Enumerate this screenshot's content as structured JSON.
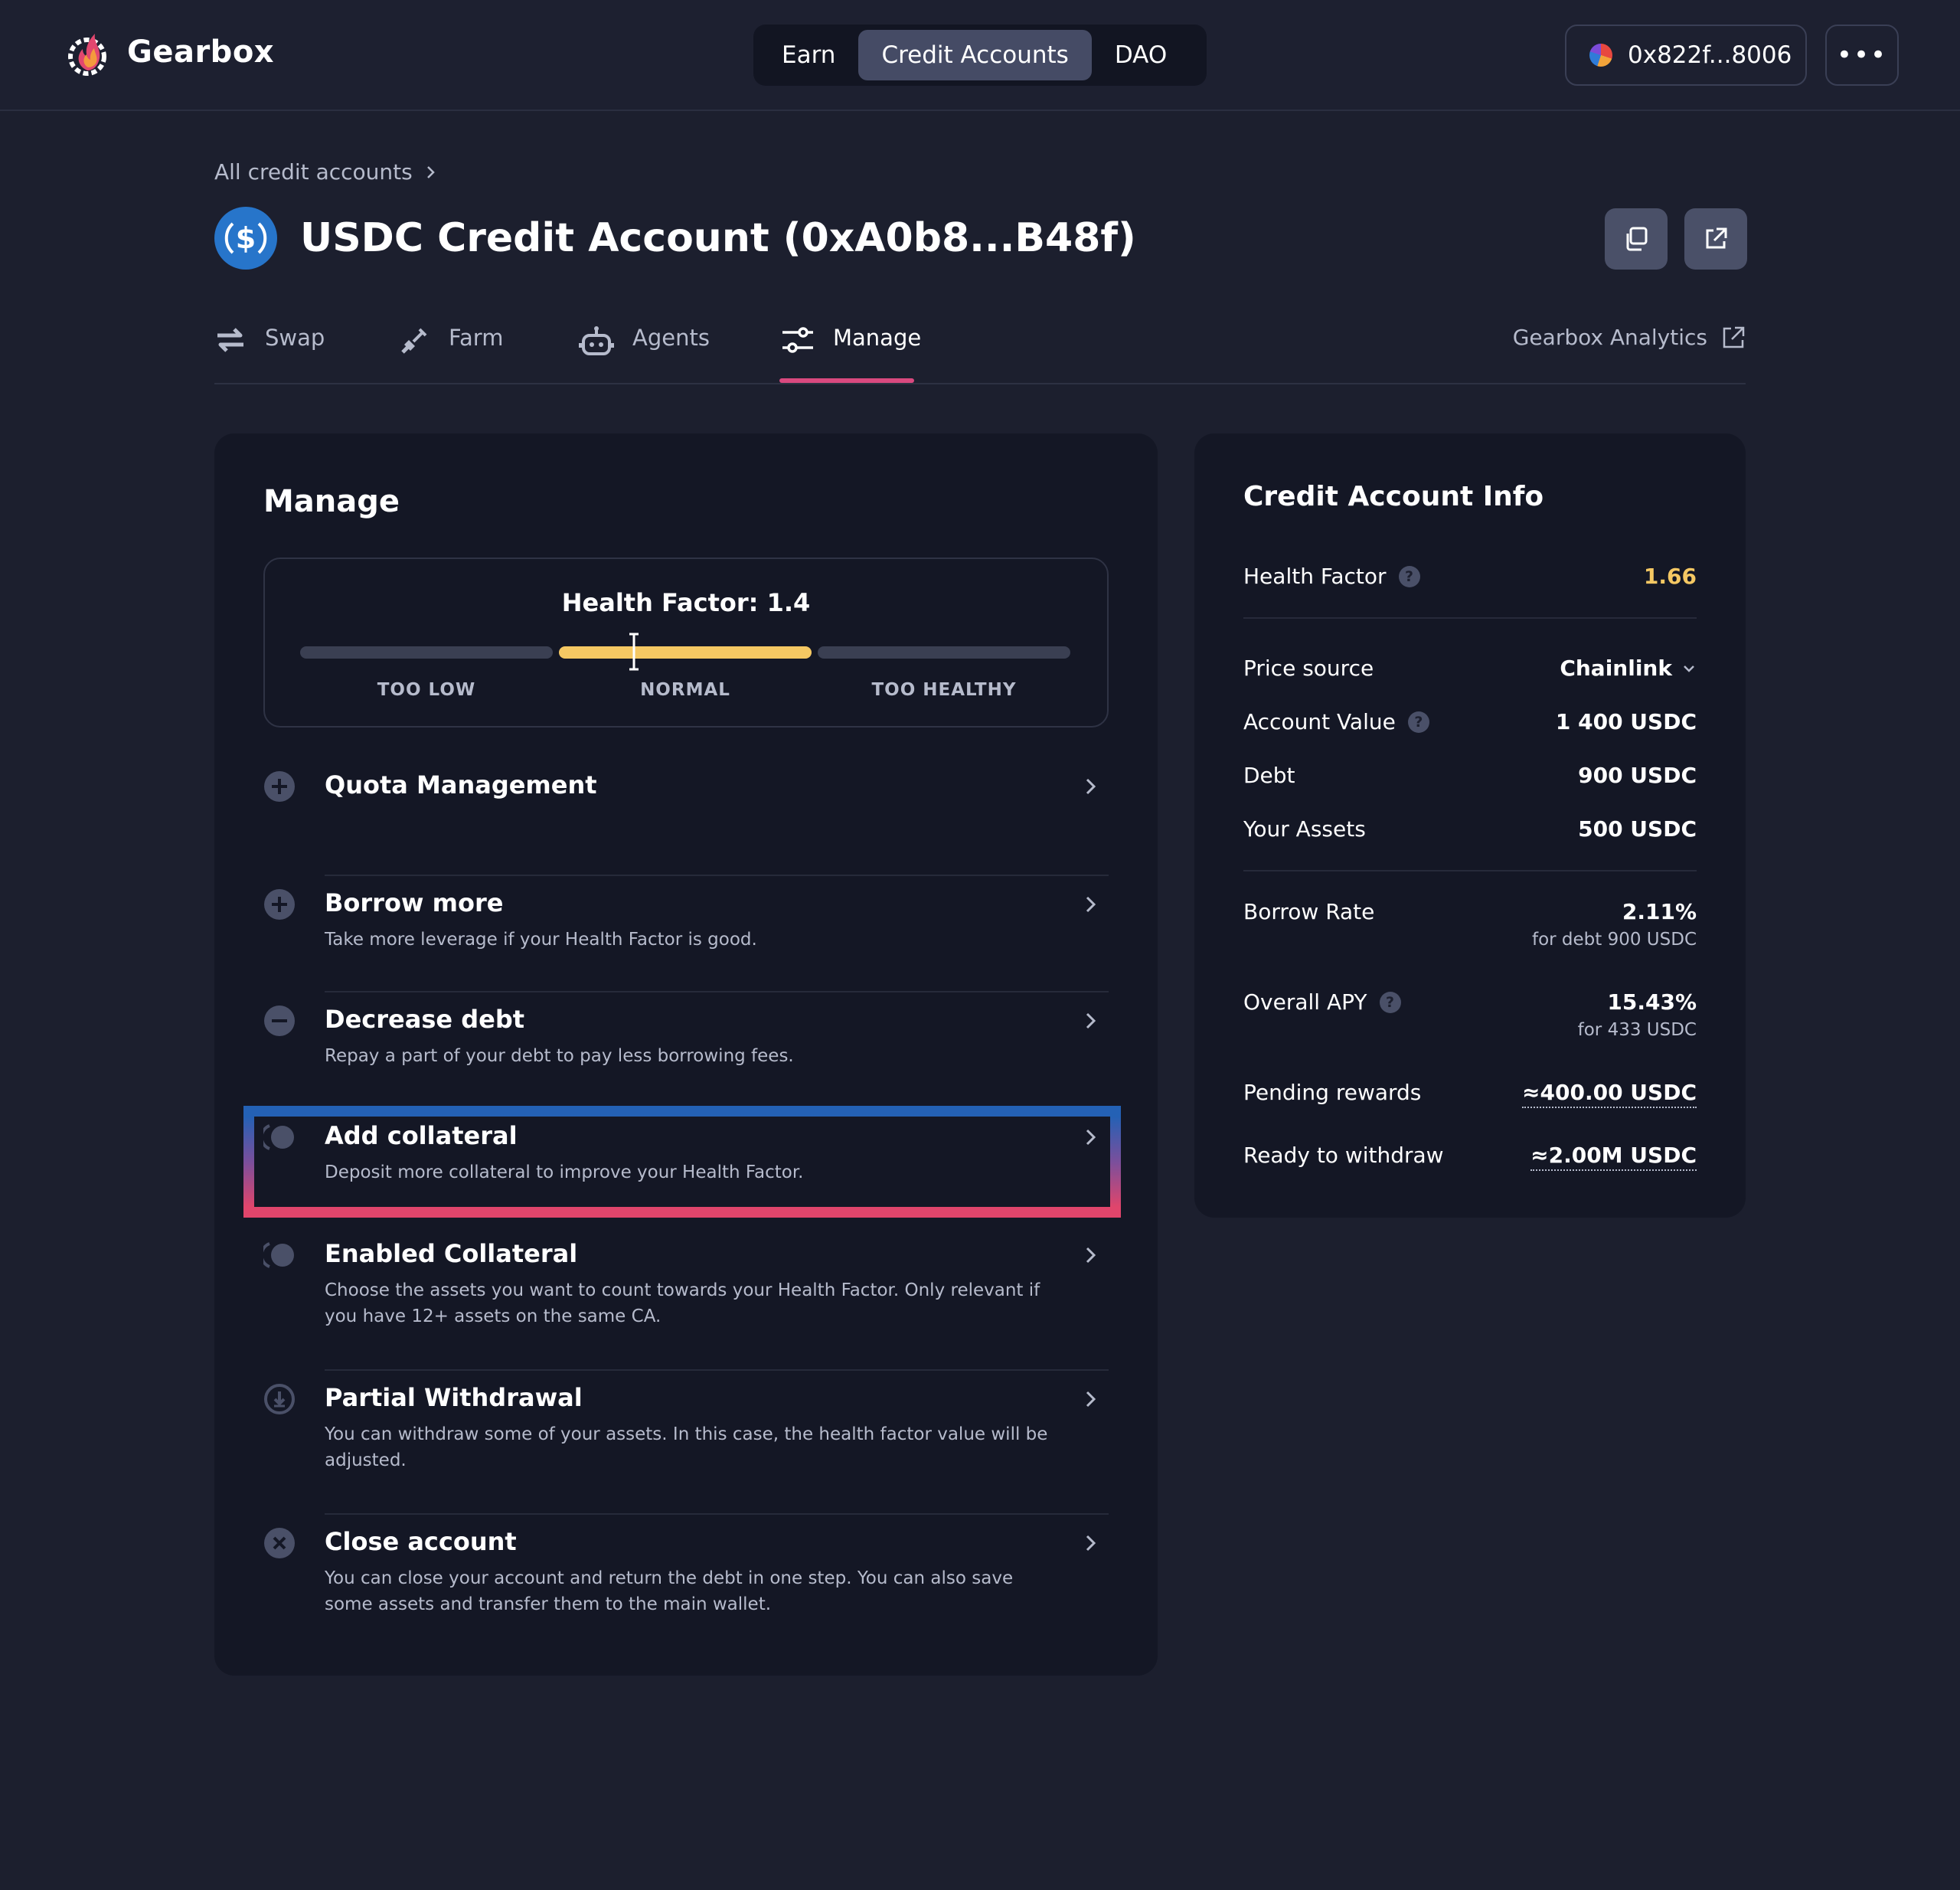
{
  "header": {
    "brand": "Gearbox",
    "nav": [
      {
        "label": "Earn",
        "active": false
      },
      {
        "label": "Credit Accounts",
        "active": true
      },
      {
        "label": "DAO",
        "active": false
      }
    ],
    "wallet_address": "0x822f...8006",
    "more_label": "•••"
  },
  "breadcrumb": {
    "link": "All credit accounts"
  },
  "page": {
    "title": "USDC Credit Account (0xA0b8...B48f)"
  },
  "tabs": [
    {
      "label": "Swap",
      "icon": "swap-icon"
    },
    {
      "label": "Farm",
      "icon": "shovel-icon"
    },
    {
      "label": "Agents",
      "icon": "robot-icon"
    },
    {
      "label": "Manage",
      "icon": "sliders-icon",
      "active": true
    }
  ],
  "analytics_link": "Gearbox Analytics",
  "manage": {
    "title": "Manage",
    "health": {
      "label": "Health Factor: 1.4",
      "value": 1.4,
      "zones": [
        "TOO LOW",
        "NORMAL",
        "TOO HEALTHY"
      ],
      "active_color": "#f5c863"
    },
    "actions": [
      {
        "title": "Quota Management",
        "desc": "",
        "icon": "plus-circle-icon"
      },
      {
        "title": "Borrow more",
        "desc": "Take more leverage if your Health Factor is good.",
        "icon": "plus-circle-icon"
      },
      {
        "title": "Decrease debt",
        "desc": "Repay a part of your debt to pay less borrowing fees.",
        "icon": "minus-circle-icon"
      },
      {
        "title": "Add collateral",
        "desc": "Deposit more collateral to improve your Health Factor.",
        "icon": "collateral-icon"
      },
      {
        "title": "Enabled Collateral",
        "desc": "Choose the assets you want to count towards your Health Factor. Only relevant if you have 12+ assets on the same CA.",
        "icon": "collateral-icon"
      },
      {
        "title": "Partial Withdrawal",
        "desc": "You can withdraw some of your assets. In this case, the health factor value will be adjusted.",
        "icon": "withdraw-icon"
      },
      {
        "title": "Close account",
        "desc": "You can close your account and return the debt in one step. You can also save some assets and transfer them to the main wallet.",
        "icon": "close-circle-icon"
      }
    ]
  },
  "info": {
    "title": "Credit Account Info",
    "health_factor": {
      "label": "Health Factor",
      "value": "1.66",
      "color": "#f5c863"
    },
    "price_source": {
      "label": "Price source",
      "value": "Chainlink"
    },
    "account_value": {
      "label": "Account Value",
      "value": "1 400 USDC"
    },
    "debt": {
      "label": "Debt",
      "value": "900 USDC"
    },
    "your_assets": {
      "label": "Your Assets",
      "value": "500 USDC"
    },
    "borrow_rate": {
      "label": "Borrow Rate",
      "value": "2.11%",
      "sub": "for debt 900 USDC"
    },
    "overall_apy": {
      "label": "Overall APY",
      "value": "15.43%",
      "sub": "for 433 USDC"
    },
    "pending_rewards": {
      "label": "Pending rewards",
      "value": "≈400.00 USDC"
    },
    "ready_to_withdraw": {
      "label": "Ready to withdraw",
      "value": "≈2.00M USDC"
    }
  },
  "colors": {
    "background": "#1c1f2e",
    "card": "#141725",
    "accent_pink": "#d9497f",
    "usdc_blue": "#2775ca"
  }
}
